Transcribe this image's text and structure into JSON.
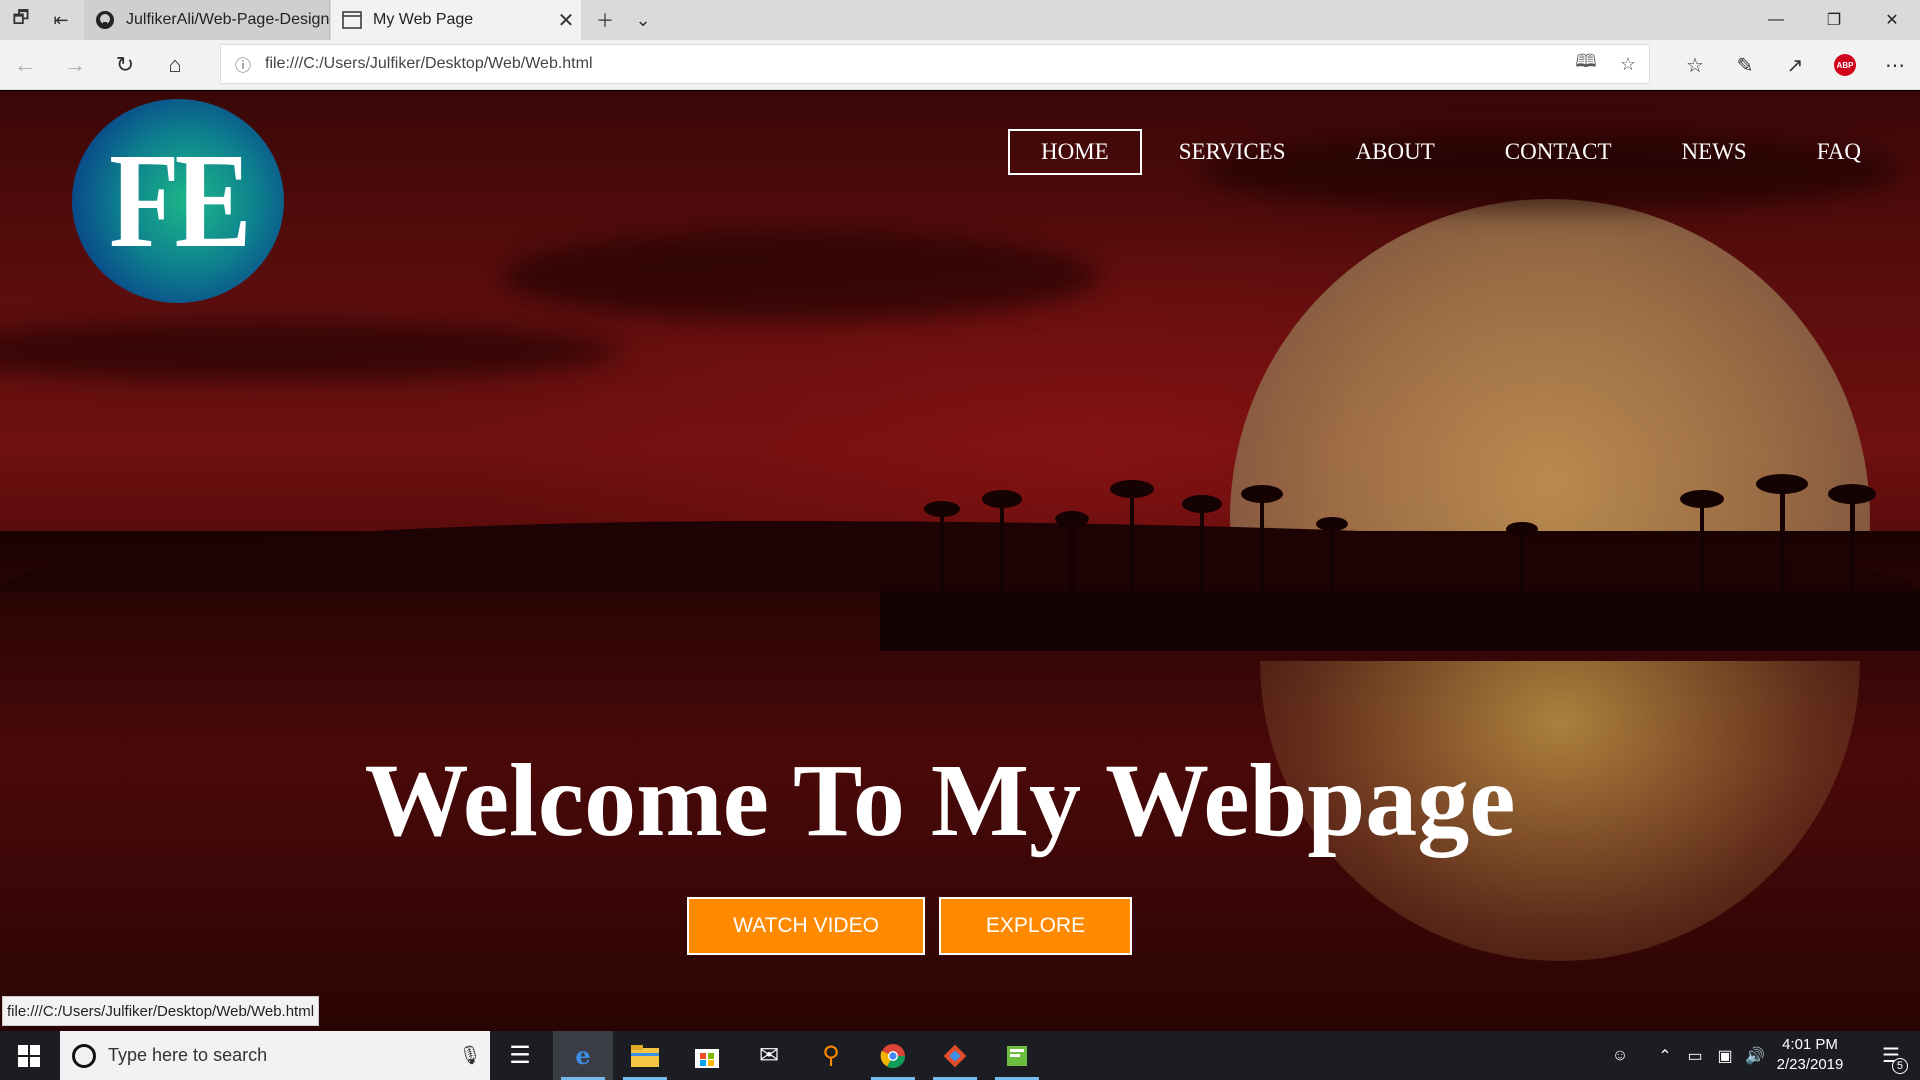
{
  "browser": {
    "tabs": [
      {
        "title": "JulfikerAli/Web-Page-Design",
        "favicon": "github-icon"
      },
      {
        "title": "My Web Page",
        "favicon": "page-icon"
      }
    ],
    "url": "file:///C:/Users/Julfiker/Desktop/Web/Web.html",
    "status_url": "file:///C:/Users/Julfiker/Desktop/Web/Web.html"
  },
  "site": {
    "logo_text": "FE",
    "nav": [
      {
        "label": "HOME",
        "active": true
      },
      {
        "label": "SERVICES",
        "active": false
      },
      {
        "label": "ABOUT",
        "active": false
      },
      {
        "label": "CONTACT",
        "active": false
      },
      {
        "label": "NEWS",
        "active": false
      },
      {
        "label": "FAQ",
        "active": false
      }
    ],
    "headline": "Welcome To My Webpage",
    "buttons": {
      "watch": "WATCH VIDEO",
      "explore": "EXPLORE"
    },
    "accent_color": "#ff8a00"
  },
  "taskbar": {
    "search_placeholder": "Type here to search",
    "time": "4:01 PM",
    "date": "2/23/2019",
    "notification_count": "5"
  }
}
